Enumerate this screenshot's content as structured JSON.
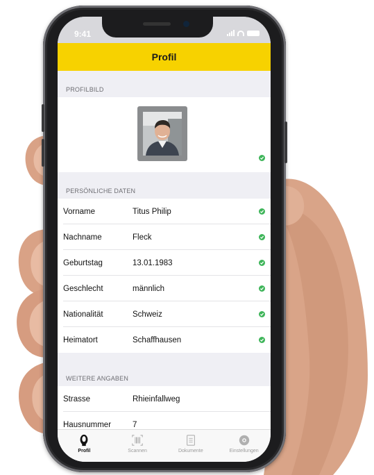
{
  "status_bar": {
    "time": "9:41"
  },
  "nav": {
    "title": "Profil"
  },
  "sections": {
    "profile_picture": "PROFILBILD",
    "personal_data": "PERSÖNLICHE DATEN",
    "further_info": "WEITERE ANGABEN"
  },
  "personal": [
    {
      "label": "Vorname",
      "value": "Titus Philip"
    },
    {
      "label": "Nachname",
      "value": "Fleck"
    },
    {
      "label": "Geburtstag",
      "value": "13.01.1983"
    },
    {
      "label": "Geschlecht",
      "value": "männlich"
    },
    {
      "label": "Nationalität",
      "value": "Schweiz"
    },
    {
      "label": "Heimatort",
      "value": "Schaffhausen"
    }
  ],
  "further": [
    {
      "label": "Strasse",
      "value": "Rhieinfallweg"
    },
    {
      "label": "Hausnummer",
      "value": "7"
    }
  ],
  "tabs": [
    {
      "label": "Profil",
      "icon": "person-icon",
      "active": true
    },
    {
      "label": "Scannen",
      "icon": "barcode-icon",
      "active": false
    },
    {
      "label": "Dokumente",
      "icon": "document-icon",
      "active": false
    },
    {
      "label": "Einstellungen",
      "icon": "gear-icon",
      "active": false
    }
  ],
  "colors": {
    "accent": "#f7d200",
    "check": "#3fb55a",
    "background": "#efeff4"
  }
}
